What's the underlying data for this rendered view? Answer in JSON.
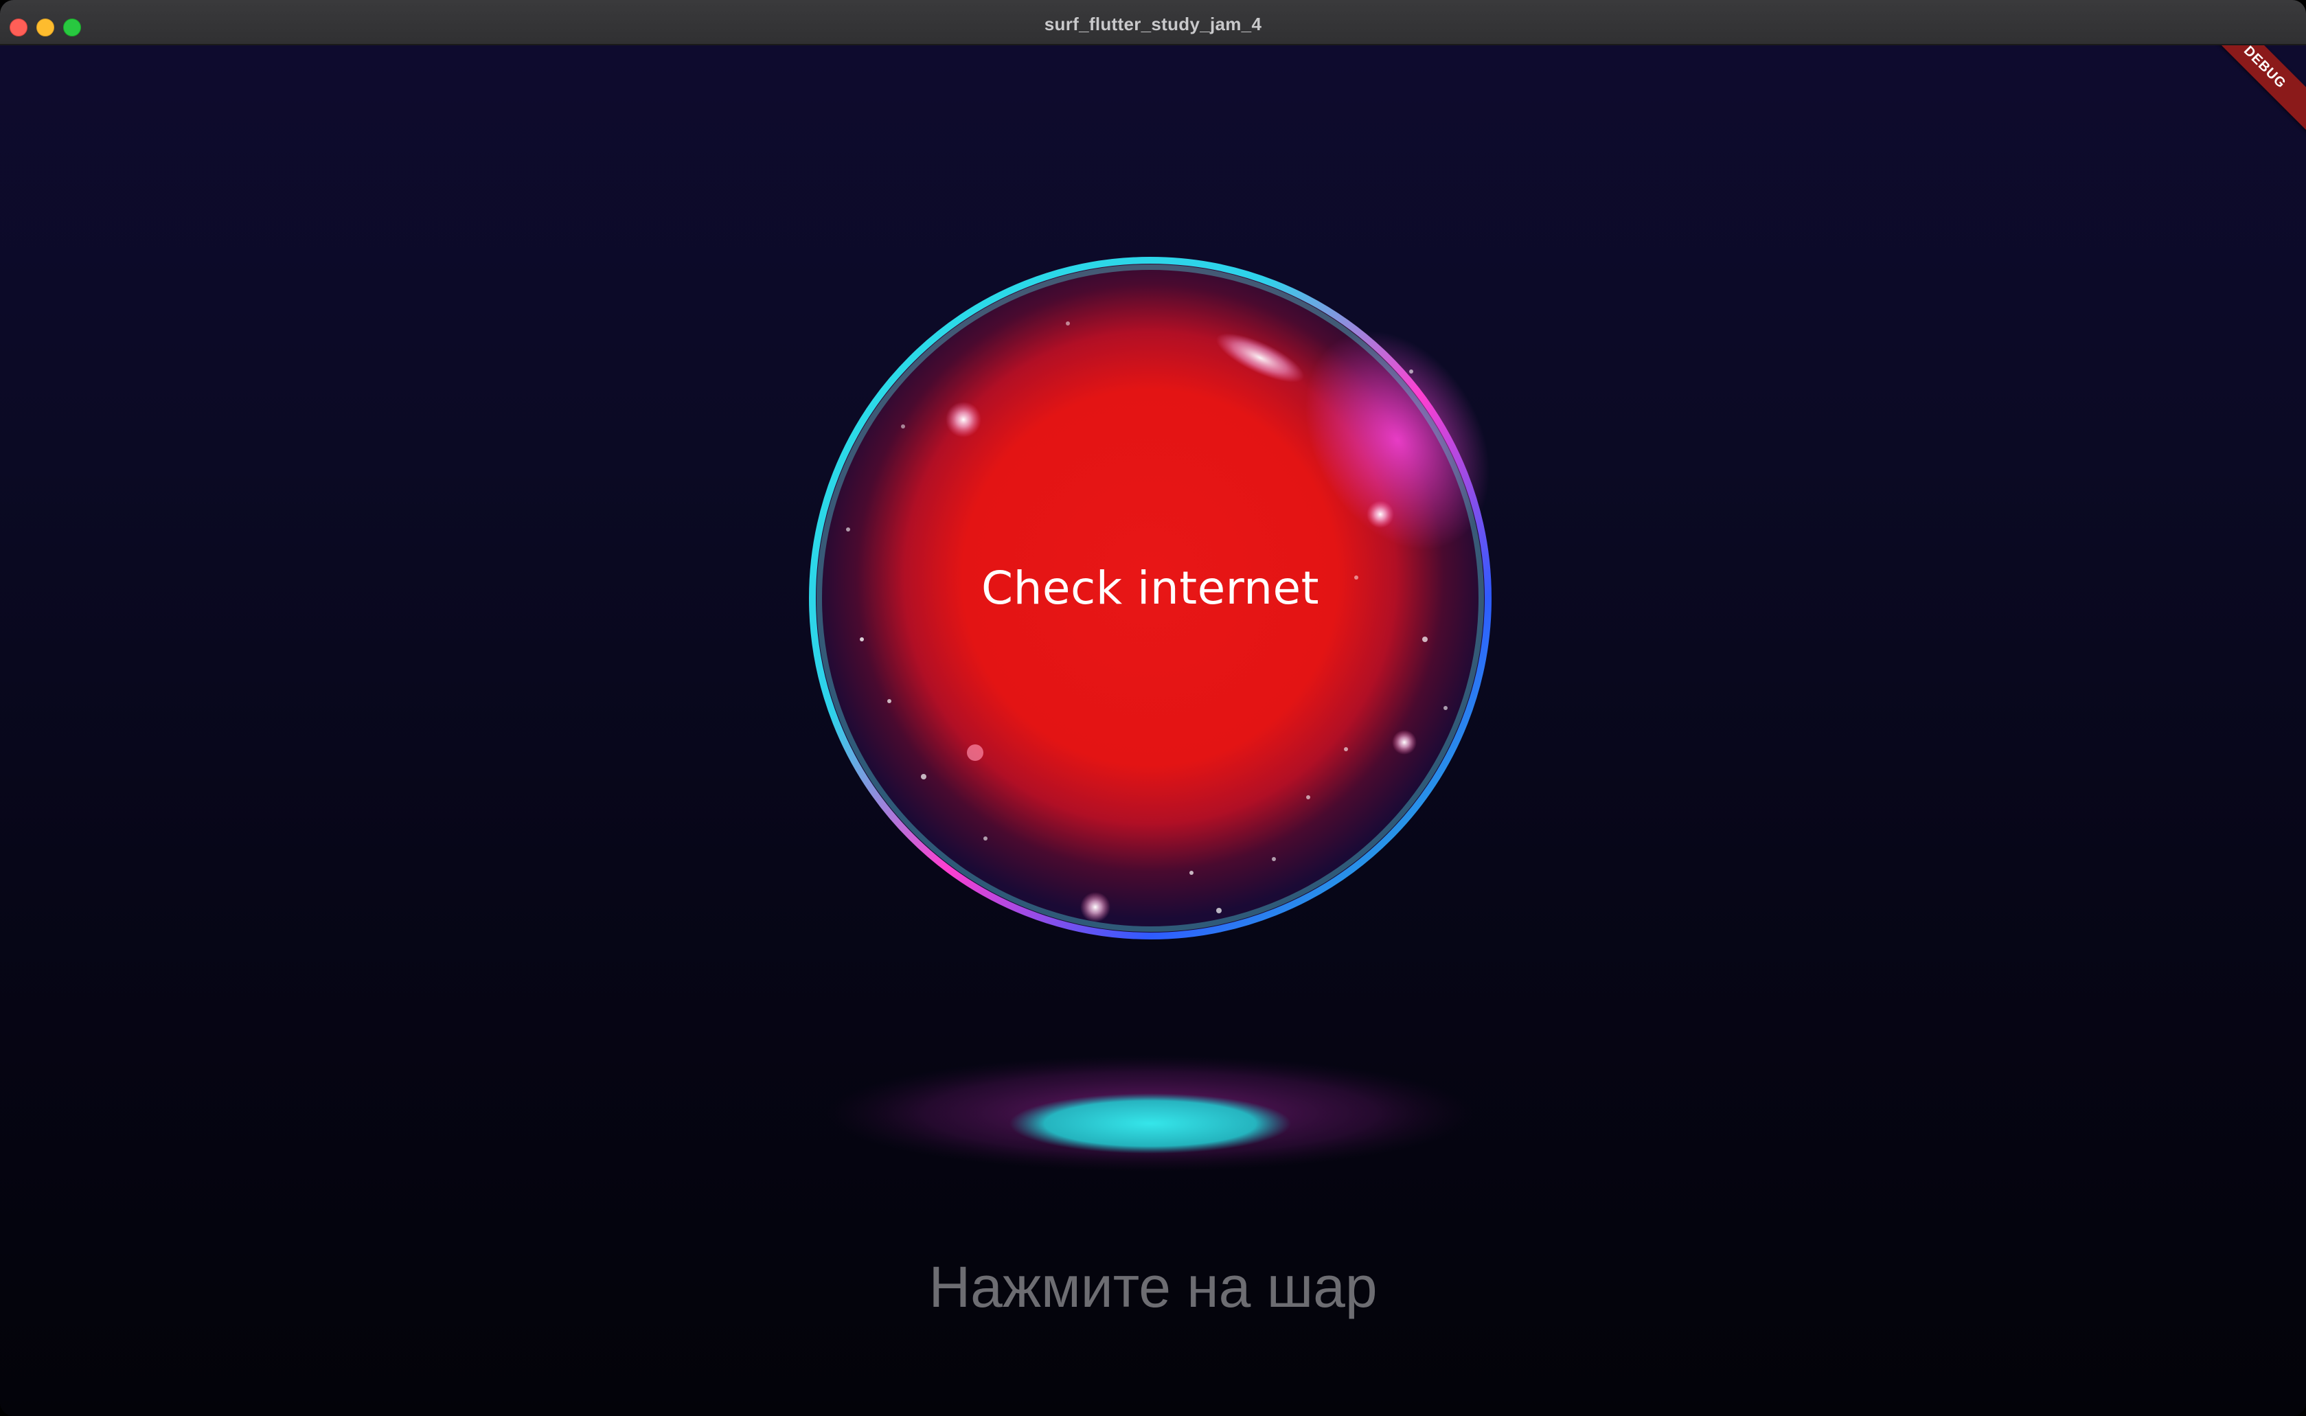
{
  "window": {
    "title": "surf_flutter_study_jam_4"
  },
  "debug_banner": {
    "label": "DEBUG",
    "color": "#8b1a1a"
  },
  "ball": {
    "text": "Check internet",
    "core_color": "#e31515",
    "rim_colors": [
      "#29e0e6",
      "#ff3fd0",
      "#2f5bff"
    ]
  },
  "shadow": {
    "glow_color": "#2ad4d8",
    "halo_color": "#7a1f7a"
  },
  "hint": {
    "text": "Нажмите на шар",
    "color": "#6d6d72"
  }
}
